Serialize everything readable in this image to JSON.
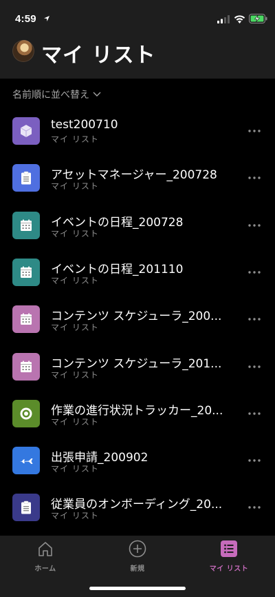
{
  "status": {
    "time": "4:59"
  },
  "header": {
    "title": "マイ リスト"
  },
  "sort": {
    "label": "名前順に並べ替え"
  },
  "lists": [
    {
      "title": "test200710",
      "subtitle": "マイ リスト",
      "icon": "cube-icon",
      "color": "#7b5fc0"
    },
    {
      "title": "アセットマネージャー_200728",
      "subtitle": "マイ リスト",
      "icon": "clipboard-icon",
      "color": "#4f6fe0"
    },
    {
      "title": "イベントの日程_200728",
      "subtitle": "マイ リスト",
      "icon": "calendar-icon",
      "color": "#2e8a86"
    },
    {
      "title": "イベントの日程_201110",
      "subtitle": "マイ リスト",
      "icon": "calendar-icon",
      "color": "#2e8a86"
    },
    {
      "title": "コンテンツ スケジューラ_200...",
      "subtitle": "マイ リスト",
      "icon": "calendar-icon",
      "color": "#b974b0"
    },
    {
      "title": "コンテンツ スケジューラ_201...",
      "subtitle": "マイ リスト",
      "icon": "calendar-icon",
      "color": "#b974b0"
    },
    {
      "title": "作業の進行状況トラッカー_20...",
      "subtitle": "マイ リスト",
      "icon": "target-icon",
      "color": "#5b8c2a"
    },
    {
      "title": "出張申請_200902",
      "subtitle": "マイ リスト",
      "icon": "airplane-icon",
      "color": "#3478e0"
    },
    {
      "title": "従業員のオンボーディング_20...",
      "subtitle": "マイ リスト",
      "icon": "clipboard-icon",
      "color": "#3a3a8a"
    }
  ],
  "tabs": [
    {
      "label": "ホーム",
      "icon": "home-icon"
    },
    {
      "label": "新規",
      "icon": "plus-circle-icon"
    },
    {
      "label": "マイ リスト",
      "icon": "list-icon",
      "active": true
    }
  ],
  "colors": {
    "accent": "#c66bbb",
    "background": "#000000",
    "header": "#1e1e1e"
  }
}
